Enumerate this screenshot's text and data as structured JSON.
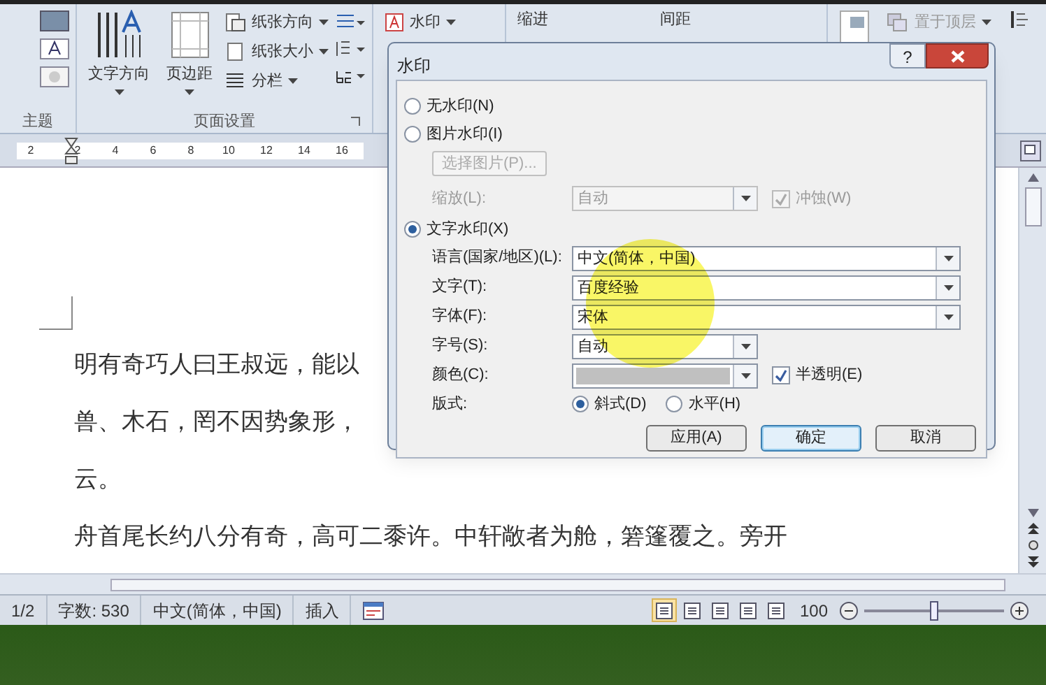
{
  "ribbon": {
    "theme_group": {
      "label": "主题"
    },
    "page_setup": {
      "label": "页面设置",
      "big_buttons": [
        "文字方向",
        "页边距"
      ],
      "small_buttons": [
        "纸张方向",
        "纸张大小",
        "分栏"
      ]
    },
    "watermark_button": "水印",
    "indent_label": "缩进",
    "spacing_label": "间距",
    "bring_front_button": "置于顶层"
  },
  "ruler": {
    "ticks": [
      "2",
      "2",
      "4",
      "6",
      "8",
      "10",
      "12",
      "14",
      "16"
    ]
  },
  "document": {
    "lines": [
      "明有奇巧人曰王叔远，能以",
      "兽、木石，罔不因势象形，",
      "云。",
      "舟首尾长约八分有奇，高可二黍许。中轩敞者为舱，箬篷覆之。旁开"
    ]
  },
  "dialog": {
    "title": "水印",
    "help": "?",
    "no_watermark": {
      "label": "无水印(N)",
      "selected": false
    },
    "picture_watermark": {
      "label": "图片水印(I)",
      "selected": false
    },
    "select_picture": {
      "label": "选择图片(P)...",
      "disabled": true
    },
    "scale": {
      "label": "缩放(L):",
      "value": "自动",
      "disabled": true
    },
    "washout": {
      "label": "冲蚀(W)",
      "checked": true,
      "disabled": true
    },
    "text_watermark": {
      "label": "文字水印(X)",
      "selected": true
    },
    "fields": [
      {
        "kind": "wide",
        "label": "语言(国家/地区)(L):",
        "value": "中文(简体，中国)"
      },
      {
        "kind": "wide",
        "label": "文字(T):",
        "value": "百度经验"
      },
      {
        "kind": "wide",
        "label": "字体(F):",
        "value": "宋体"
      },
      {
        "kind": "narrow",
        "label": "字号(S):",
        "value": "自动"
      }
    ],
    "color": {
      "label": "颜色(C):"
    },
    "semitransparent": {
      "label": "半透明(E)",
      "checked": true
    },
    "layout": {
      "label": "版式:",
      "options": [
        {
          "label": "斜式(D)",
          "selected": true
        },
        {
          "label": "水平(H)",
          "selected": false
        }
      ]
    },
    "buttons": [
      {
        "label": "应用(A)",
        "default": false
      },
      {
        "label": "确定",
        "default": true
      },
      {
        "label": "取消",
        "default": false
      }
    ]
  },
  "status_bar": {
    "page": "1/2",
    "words": "字数: 530",
    "language": "中文(简体，中国)",
    "mode": "插入",
    "views": [
      {
        "selected": true
      },
      {
        "selected": false
      },
      {
        "selected": false
      },
      {
        "selected": false
      },
      {
        "selected": false
      }
    ],
    "zoom": {
      "reading": "100",
      "level": 0.5
    }
  }
}
